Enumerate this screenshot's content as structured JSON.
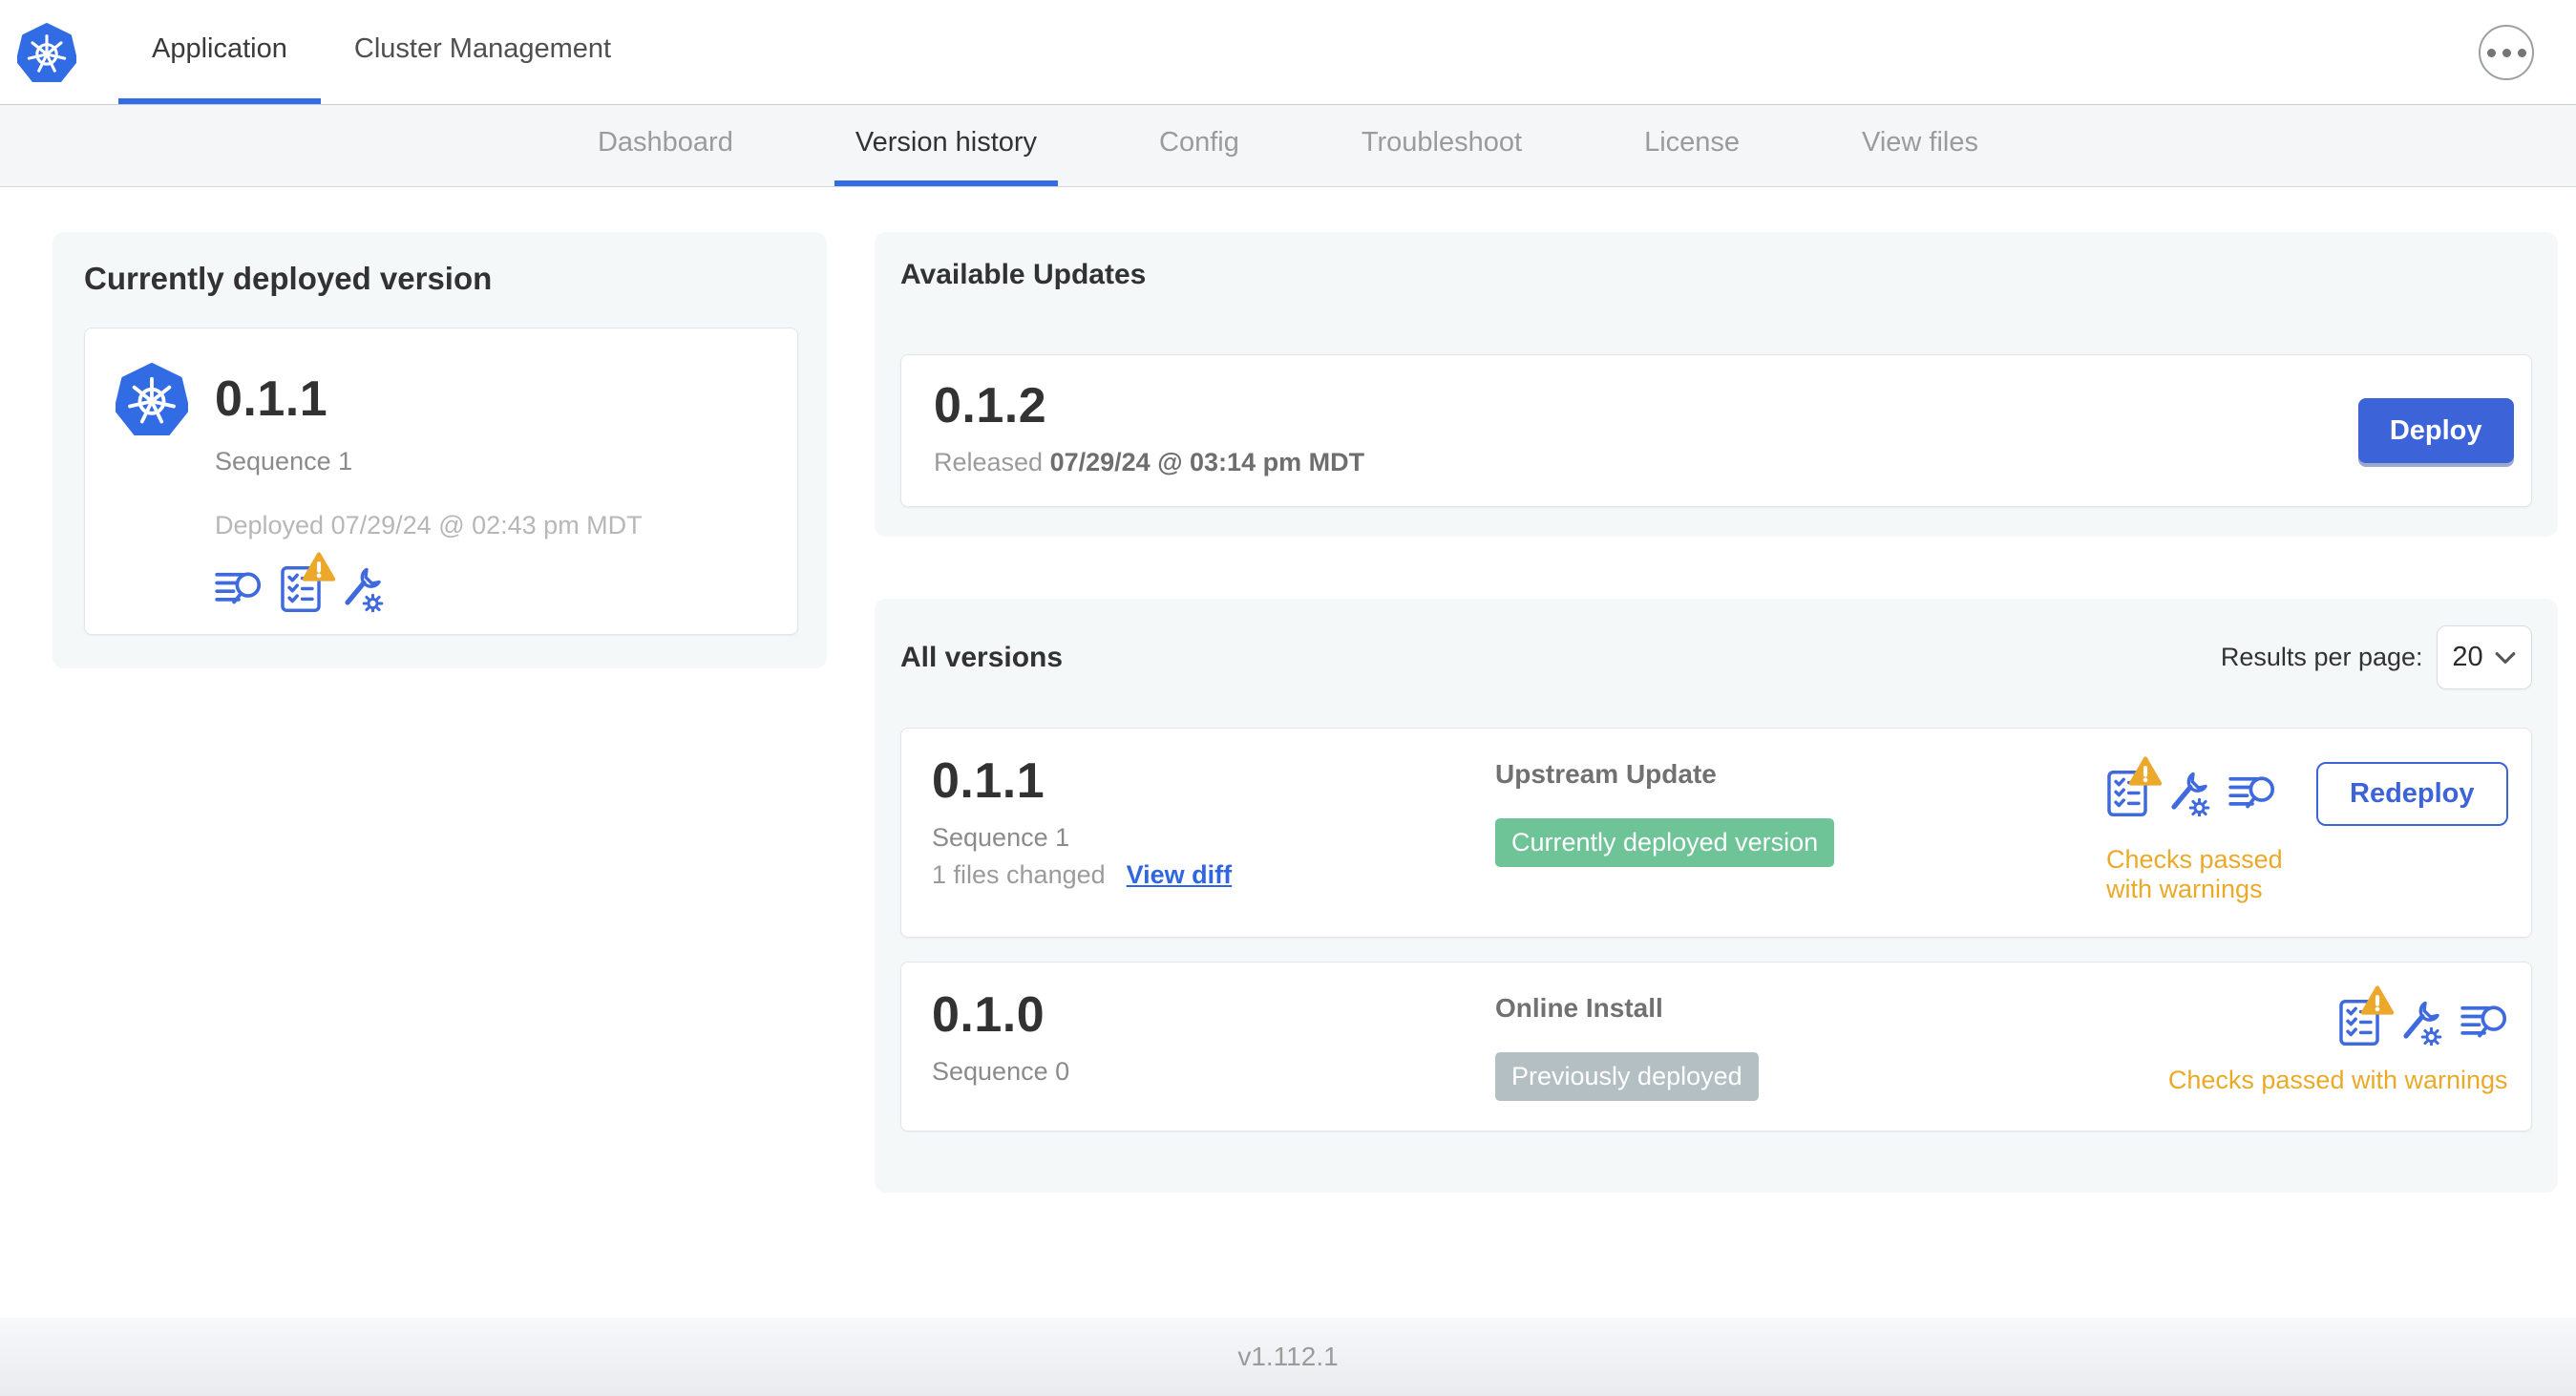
{
  "topnav": {
    "tabs": [
      {
        "label": "Application"
      },
      {
        "label": "Cluster Management"
      }
    ],
    "active_tab": "Application"
  },
  "subnav": {
    "tabs": [
      {
        "label": "Dashboard"
      },
      {
        "label": "Version history"
      },
      {
        "label": "Config"
      },
      {
        "label": "Troubleshoot"
      },
      {
        "label": "License"
      },
      {
        "label": "View files"
      }
    ],
    "active_tab": "Version history"
  },
  "deployed_card": {
    "title": "Currently deployed version",
    "version": "0.1.1",
    "sequence": "Sequence 1",
    "deployed_prefix": "Deployed",
    "deployed_at": "07/29/24 @ 02:43 pm MDT"
  },
  "available_updates": {
    "title": "Available Updates",
    "version": "0.1.2",
    "released_prefix": "Released",
    "released_at": "07/29/24 @ 03:14 pm MDT",
    "deploy_label": "Deploy"
  },
  "all_versions": {
    "title": "All versions",
    "results_per_page": {
      "label": "Results per page:",
      "value": "20"
    },
    "rows": [
      {
        "version": "0.1.1",
        "sequence": "Sequence 1",
        "files_changed": "1 files changed",
        "view_diff_label": "View diff",
        "source": "Upstream Update",
        "status_badge": "Currently deployed version",
        "badge_style": "green",
        "checks_text": "Checks passed with warnings",
        "action_label": "Redeploy"
      },
      {
        "version": "0.1.0",
        "sequence": "Sequence 0",
        "source": "Online Install",
        "status_badge": "Previously deployed",
        "badge_style": "gray",
        "checks_text": "Checks passed with warnings"
      }
    ]
  },
  "footer": {
    "version": "v1.112.1"
  },
  "icon_names": {
    "brand": "kubernetes-logo",
    "overflow_menu": "ellipsis-menu-icon",
    "release_notes": "release-notes-icon",
    "preflight_checks": "preflight-checks-icon",
    "warning": "warning-triangle-icon",
    "config": "config-wrench-icon",
    "select_chevron": "chevron-down-icon"
  },
  "colors": {
    "accent_blue": "#3c63d8",
    "link_blue": "#3066e0",
    "logo_blue": "#326CE5",
    "tab_underline_blue": "#326de6",
    "badge_green": "#6ec497",
    "badge_gray": "#b3bfc3",
    "warning_orange": "#eba928",
    "text_dark": "#323232",
    "text_gray": "#717171",
    "text_light": "#9b9b9b"
  }
}
